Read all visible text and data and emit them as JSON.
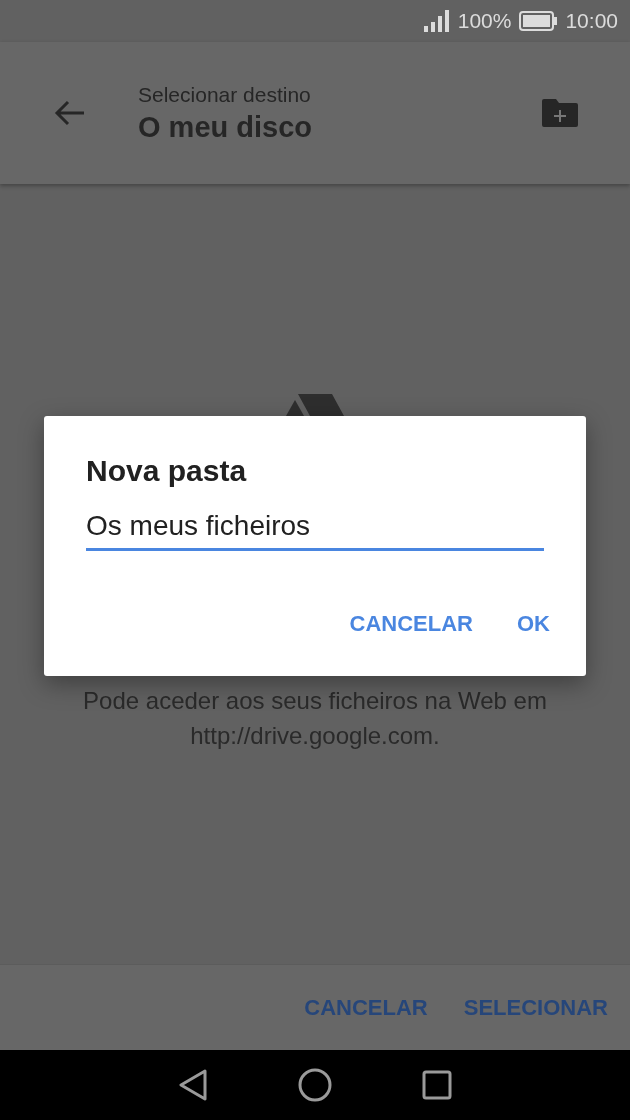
{
  "status_bar": {
    "battery": "100%",
    "time": "10:00"
  },
  "toolbar": {
    "subtitle": "Selecionar destino",
    "title": "O meu disco"
  },
  "empty_state": {
    "text": "Pode aceder aos seus ficheiros na Web em http://drive.google.com."
  },
  "bottom_bar": {
    "buttons": [
      "CANCELAR",
      "SELECIONAR"
    ]
  },
  "dialog": {
    "title": "Nova pasta",
    "field": {
      "value": "Os meus ficheiros",
      "focused": true
    },
    "buttons": [
      "CANCELAR",
      "OK"
    ]
  }
}
